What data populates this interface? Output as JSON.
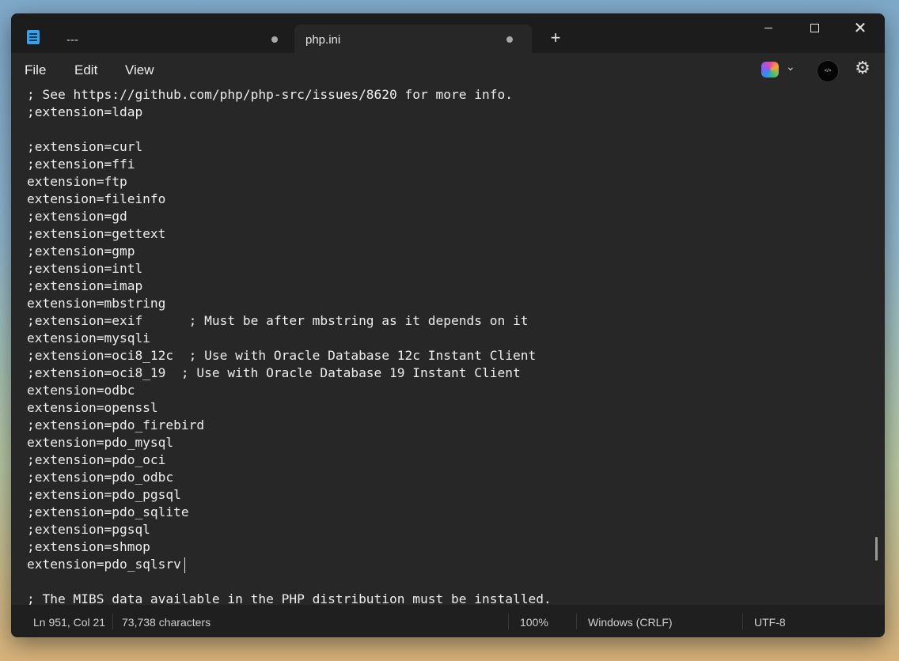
{
  "window": {
    "tabs": [
      {
        "label": "---",
        "active": false
      },
      {
        "label": "php.ini",
        "active": true
      }
    ],
    "new_tab_label": "+"
  },
  "menu": {
    "items": [
      "File",
      "Edit",
      "View"
    ]
  },
  "toolbar": {
    "copilot_icon": "copilot-icon",
    "chevron_icon": "chevron-down-icon",
    "avatar_text": "</>",
    "settings_icon": "gear-icon"
  },
  "editor": {
    "lines": [
      "; See https://github.com/php/php-src/issues/8620 for more info.",
      ";extension=ldap",
      "",
      ";extension=curl",
      ";extension=ffi",
      "extension=ftp",
      "extension=fileinfo",
      ";extension=gd",
      ";extension=gettext",
      ";extension=gmp",
      ";extension=intl",
      ";extension=imap",
      "extension=mbstring",
      ";extension=exif      ; Must be after mbstring as it depends on it",
      "extension=mysqli",
      ";extension=oci8_12c  ; Use with Oracle Database 12c Instant Client",
      ";extension=oci8_19  ; Use with Oracle Database 19 Instant Client",
      "extension=odbc",
      "extension=openssl",
      ";extension=pdo_firebird",
      "extension=pdo_mysql",
      ";extension=pdo_oci",
      ";extension=pdo_odbc",
      ";extension=pdo_pgsql",
      ";extension=pdo_sqlite",
      ";extension=pgsql",
      ";extension=shmop",
      "extension=pdo_sqlsrv",
      "",
      "; The MIBS data available in the PHP distribution must be installed."
    ]
  },
  "status": {
    "position": "Ln 951, Col 21",
    "characters": "73,738 characters",
    "zoom": "100%",
    "line_endings": "Windows (CRLF)",
    "encoding": "UTF-8"
  },
  "colors": {
    "background": "#272727",
    "titlebar": "#1c1c1c",
    "text": "#ededed"
  }
}
